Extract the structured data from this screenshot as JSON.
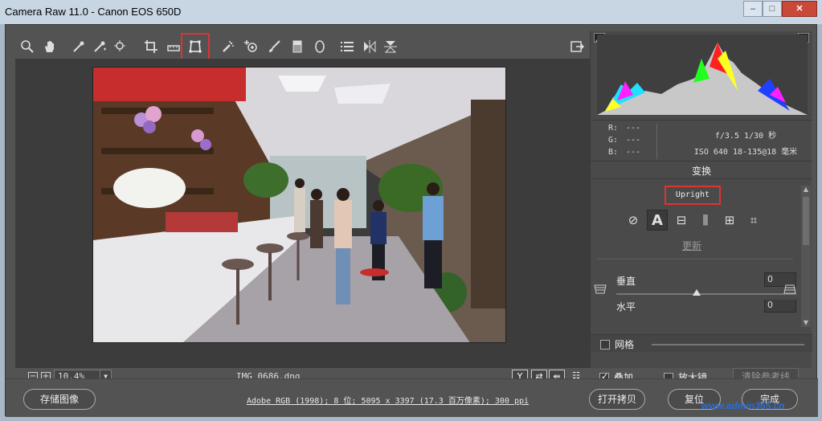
{
  "window": {
    "title": "Camera Raw 11.0 -  Canon EOS 650D",
    "minimize": "–",
    "maximize": "□",
    "close": "✕"
  },
  "toolbar": {
    "tools": [
      {
        "name": "zoom-tool-icon",
        "glyph": "🔍"
      },
      {
        "name": "hand-tool-icon",
        "glyph": "✋"
      },
      {
        "name": "white-balance-tool-icon",
        "glyph": "✎"
      },
      {
        "name": "color-sampler-tool-icon",
        "glyph": "✎"
      },
      {
        "name": "targeted-adjustment-tool-icon",
        "glyph": "◎"
      },
      {
        "name": "crop-tool-icon",
        "glyph": "⌗"
      },
      {
        "name": "straighten-tool-icon",
        "glyph": "⊟"
      },
      {
        "name": "transform-tool-icon",
        "glyph": "⊡"
      },
      {
        "name": "spot-removal-tool-icon",
        "glyph": "✦"
      },
      {
        "name": "red-eye-removal-tool-icon",
        "glyph": "⊕"
      },
      {
        "name": "adjustment-brush-icon",
        "glyph": "✐"
      },
      {
        "name": "graduated-filter-icon",
        "glyph": "▮"
      },
      {
        "name": "radial-filter-icon",
        "glyph": "◯"
      },
      {
        "name": "preferences-icon",
        "glyph": "☰"
      },
      {
        "name": "rotate-icon",
        "glyph": "⧓"
      },
      {
        "name": "flip-icon",
        "glyph": "⧗"
      }
    ],
    "open_in_photoshop_glyph": "⇥"
  },
  "image_area": {
    "zoom_minus": "−",
    "zoom_plus": "+",
    "zoom_level": "10.4%",
    "filename": "IMG_0686.dng",
    "status_buttons": [
      "Y",
      "⇄",
      "⇚",
      "☷"
    ]
  },
  "histogram": {
    "colors": {
      "red": "#ff2020",
      "green": "#20ff20",
      "blue": "#2040ff",
      "yellow": "#ffff20",
      "magenta": "#ff20ff",
      "cyan": "#20e0ff",
      "gray": "#c8c8c8"
    }
  },
  "readout": {
    "r_label": "R:",
    "r_val": "---",
    "g_label": "G:",
    "g_val": "---",
    "b_label": "B:",
    "b_val": "---",
    "exposure": "f/3.5  1/30 秒",
    "lens": "ISO 640  18-135@18 毫米"
  },
  "transform_panel": {
    "title": "变换",
    "upright_label": "Upright",
    "upright_buttons": [
      {
        "name": "upright-off-button",
        "glyph": "⊘"
      },
      {
        "name": "upright-auto-button",
        "glyph": "A"
      },
      {
        "name": "upright-level-button",
        "glyph": "⊟"
      },
      {
        "name": "upright-vertical-button",
        "glyph": "⫼"
      },
      {
        "name": "upright-full-button",
        "glyph": "⊞"
      },
      {
        "name": "upright-guided-button",
        "glyph": "⌗"
      }
    ],
    "update_label": "更新",
    "vertical_label": "垂直",
    "vertical_value": "0",
    "horizontal_label": "水平",
    "horizontal_value": "0",
    "grid_label": "网格",
    "overlay_label": "叠加",
    "loupe_label": "放大镜",
    "clear_guides_label": "清除参考线"
  },
  "bottom": {
    "save_label": "存储图像",
    "workflow_text": "Adobe RGB (1998); 8 位; 5095 x 3397 (17.3 百万像素); 300 ppi",
    "open_copy_label": "打开拷贝",
    "reset_label": "复位",
    "done_label": "完成",
    "watermark": "www.admin365.cn"
  }
}
